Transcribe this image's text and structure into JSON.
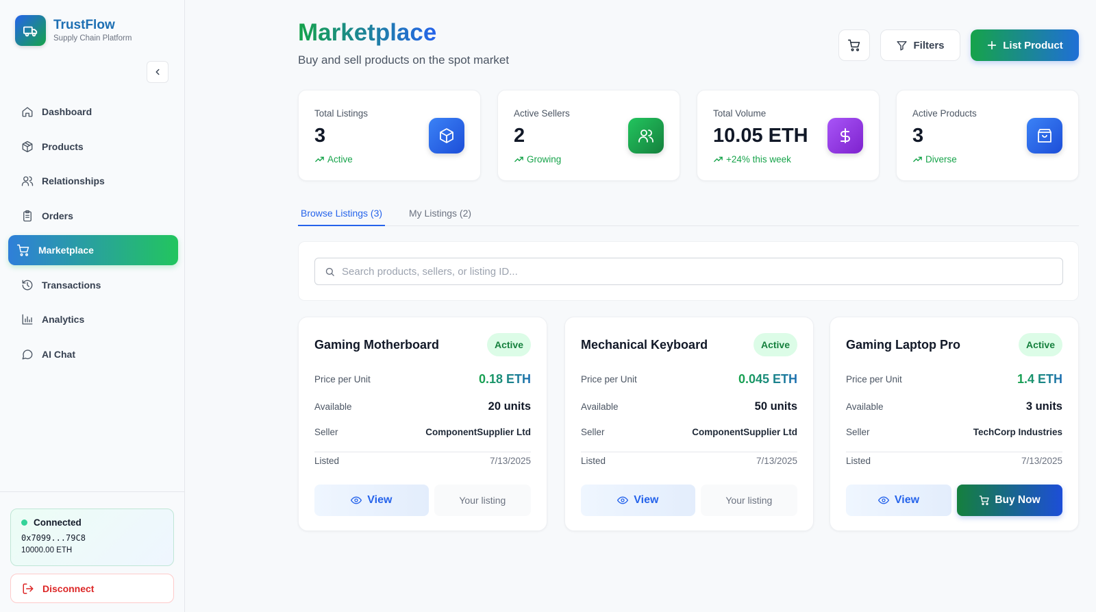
{
  "brand": {
    "name": "TrustFlow",
    "subtitle": "Supply Chain Platform"
  },
  "sidebar": {
    "items": [
      {
        "label": "Dashboard",
        "icon": "home-icon"
      },
      {
        "label": "Products",
        "icon": "package-icon"
      },
      {
        "label": "Relationships",
        "icon": "users-icon"
      },
      {
        "label": "Orders",
        "icon": "clipboard-icon"
      },
      {
        "label": "Marketplace",
        "icon": "cart-icon",
        "active": true
      },
      {
        "label": "Transactions",
        "icon": "history-icon"
      },
      {
        "label": "Analytics",
        "icon": "bar-chart-icon"
      },
      {
        "label": "AI Chat",
        "icon": "chat-icon"
      }
    ]
  },
  "wallet": {
    "status": "Connected",
    "address": "0x7099...79C8",
    "balance": "10000.00 ETH",
    "disconnect_label": "Disconnect"
  },
  "header": {
    "title": "Marketplace",
    "subtitle": "Buy and sell products on the spot market",
    "filters_label": "Filters",
    "list_label": "List Product"
  },
  "stats": [
    {
      "label": "Total Listings",
      "value": "3",
      "trend": "Active",
      "icon": "box-icon",
      "color": "#2563eb"
    },
    {
      "label": "Active Sellers",
      "value": "2",
      "trend": "Growing",
      "icon": "users-icon",
      "color": "#16a34a"
    },
    {
      "label": "Total Volume",
      "value": "10.05 ETH",
      "trend": "+24% this week",
      "icon": "dollar-icon",
      "color": "#9333ea"
    },
    {
      "label": "Active Products",
      "value": "3",
      "trend": "Diverse",
      "icon": "shopping-bag-icon",
      "color": "#2563eb"
    }
  ],
  "tabs": [
    {
      "label": "Browse Listings (3)",
      "active": true
    },
    {
      "label": "My Listings (2)"
    }
  ],
  "search": {
    "placeholder": "Search products, sellers, or listing ID..."
  },
  "listing_labels": {
    "price": "Price per Unit",
    "available": "Available",
    "seller": "Seller",
    "listed": "Listed",
    "view": "View",
    "own": "Your listing",
    "buy": "Buy Now"
  },
  "listings": [
    {
      "title": "Gaming Motherboard",
      "status": "Active",
      "price": "0.18 ETH",
      "available": "20 units",
      "seller": "ComponentSupplier Ltd",
      "listed": "7/13/2025",
      "own": true
    },
    {
      "title": "Mechanical Keyboard",
      "status": "Active",
      "price": "0.045 ETH",
      "available": "50 units",
      "seller": "ComponentSupplier Ltd",
      "listed": "7/13/2025",
      "own": true
    },
    {
      "title": "Gaming Laptop Pro",
      "status": "Active",
      "price": "1.4 ETH",
      "available": "3 units",
      "seller": "TechCorp Industries",
      "listed": "7/13/2025",
      "own": false
    }
  ]
}
